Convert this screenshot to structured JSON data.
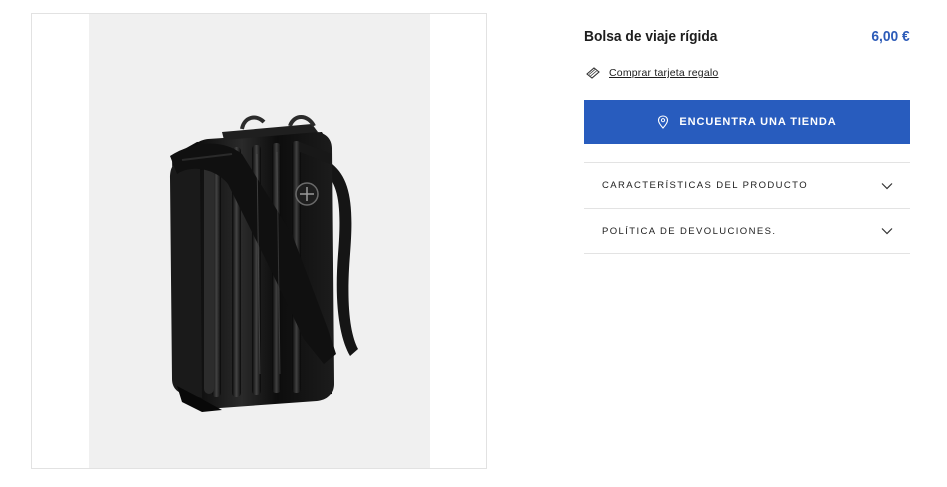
{
  "product": {
    "title": "Bolsa de viaje rígida",
    "price": "6,00 €",
    "image_alt": "black-hard-shell-crossbody-travel-bag"
  },
  "gift_link": {
    "label": "Comprar tarjeta regalo",
    "icon": "gift-card-icon"
  },
  "store_button": {
    "label": "ENCUENTRA UNA TIENDA",
    "icon": "location-pin-icon",
    "color": "#285cbe"
  },
  "accordion": [
    {
      "label": "CARACTERÍSTICAS DEL PRODUCTO",
      "icon": "chevron-down-icon"
    },
    {
      "label": "POLÍTICA DE DEVOLUCIONES.",
      "icon": "chevron-down-icon"
    }
  ],
  "colors": {
    "price": "#2c5bb8",
    "image_background": "#f0f0f0",
    "text": "#1d1d1d"
  }
}
